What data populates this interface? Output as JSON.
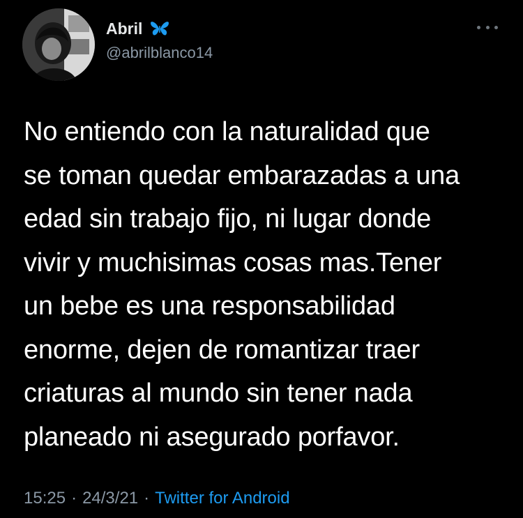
{
  "author": {
    "display_name": "Abril",
    "handle": "@abrilblanco14",
    "badge_icon": "butterfly-icon",
    "badge_color": "#1d9bf0"
  },
  "tweet": {
    "text": "No entiendo con la naturalidad que\nse toman quedar embarazadas a una\nedad sin trabajo fijo, ni lugar donde\nvivir y muchisimas cosas mas.Tener\nun bebe es una responsabilidad\nenorme, dejen de romantizar traer\ncriaturas al mundo sin tener nada\nplaneado ni asegurado porfavor.",
    "time": "15:25",
    "date": "24/3/21",
    "separator": "·",
    "source": "Twitter for Android"
  },
  "colors": {
    "background": "#000000",
    "text": "#ffffff",
    "secondary": "#8b98a5",
    "link": "#1d9bf0"
  }
}
